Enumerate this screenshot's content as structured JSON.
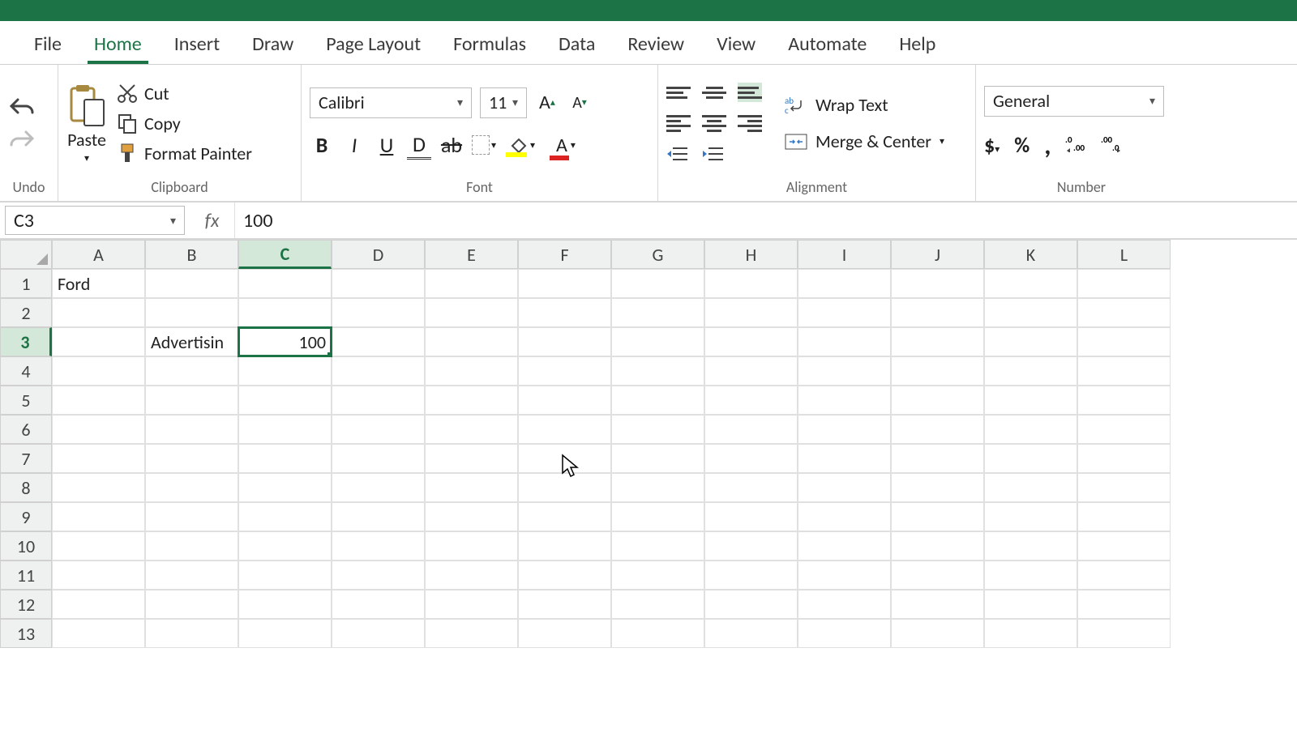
{
  "tabs": {
    "file": "File",
    "home": "Home",
    "insert": "Insert",
    "draw": "Draw",
    "page_layout": "Page Layout",
    "formulas": "Formulas",
    "data": "Data",
    "review": "Review",
    "view": "View",
    "automate": "Automate",
    "help": "Help"
  },
  "ribbon": {
    "undo_group": "Undo",
    "clipboard_group": "Clipboard",
    "font_group": "Font",
    "alignment_group": "Alignment",
    "number_group": "Number",
    "paste": "Paste",
    "cut": "Cut",
    "copy": "Copy",
    "format_painter": "Format Painter",
    "font_name": "Calibri",
    "font_size": "11",
    "wrap_text": "Wrap Text",
    "merge_center": "Merge & Center",
    "number_format": "General",
    "currency": "$",
    "percent": "%",
    "comma": ","
  },
  "name_box": "C3",
  "fx_label": "fx",
  "formula_value": "100",
  "columns": [
    "A",
    "B",
    "C",
    "D",
    "E",
    "F",
    "G",
    "H",
    "I",
    "J",
    "K",
    "L"
  ],
  "rows": [
    "1",
    "2",
    "3",
    "4",
    "5",
    "6",
    "7",
    "8",
    "9",
    "10",
    "11",
    "12",
    "13"
  ],
  "selected_col": "C",
  "selected_row": "3",
  "cells": {
    "A1": "Ford",
    "B3": "Advertisin",
    "C3": "100"
  }
}
